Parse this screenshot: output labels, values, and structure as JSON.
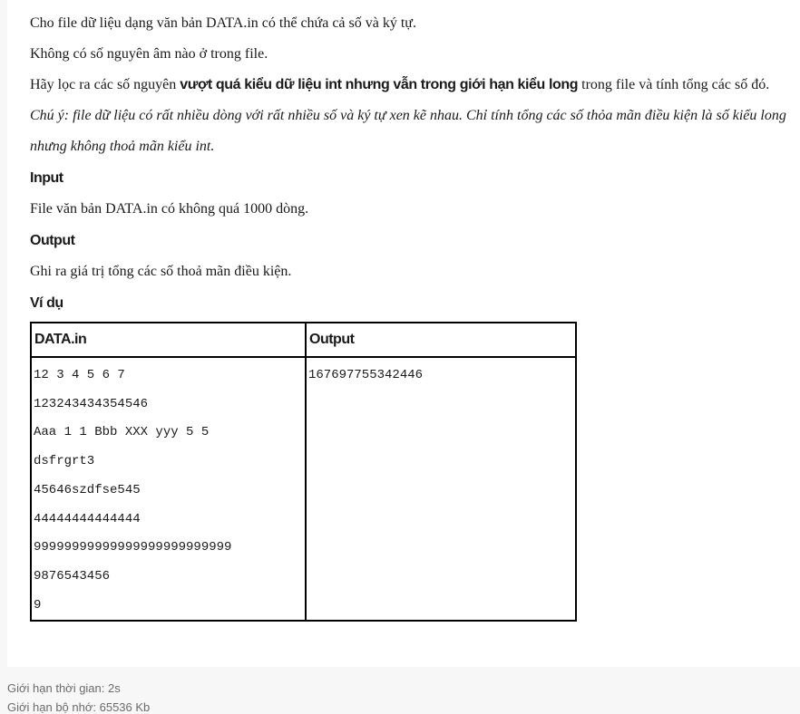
{
  "problem": {
    "line1": "Cho file dữ liệu dạng văn bản DATA.in có thể chứa cả số và ký tự.",
    "line2": "Không có số nguyên âm nào ở trong file.",
    "line3_prefix": "Hãy lọc ra các số nguyên ",
    "line3_bold": "vượt quá kiểu dữ liệu int nhưng vẫn trong giới hạn kiểu long",
    "line3_suffix": " trong file và tính tổng các số đó.",
    "note": "Chú ý: file dữ liệu có rất nhiều dòng với rất nhiều số và ký tự xen kẽ nhau. Chỉ tính tổng các số thỏa mãn điều kiện là số kiểu long nhưng không thoả mãn kiểu int."
  },
  "input_section": {
    "heading": "Input",
    "text": "File văn bản DATA.in có không quá 1000 dòng."
  },
  "output_section": {
    "heading": "Output",
    "text": "Ghi ra giá trị tổng các số thoả mãn điều kiện."
  },
  "example": {
    "heading": "Ví dụ",
    "col_input": "DATA.in",
    "col_output": "Output",
    "input_lines": [
      "12 3 4 5 6 7",
      "123243434354546",
      "Aaa 1 1 Bbb XXX yyy 5 5",
      "dsfrgrt3",
      "45646szdfse545",
      "44444444444444",
      "99999999999999999999999999",
      "9876543456",
      "9"
    ],
    "output_lines": [
      "167697755342446"
    ]
  },
  "footer": {
    "time_limit": "Giới hạn thời gian: 2s",
    "memory_limit": "Giới hạn bộ nhớ: 65536 Kb"
  }
}
